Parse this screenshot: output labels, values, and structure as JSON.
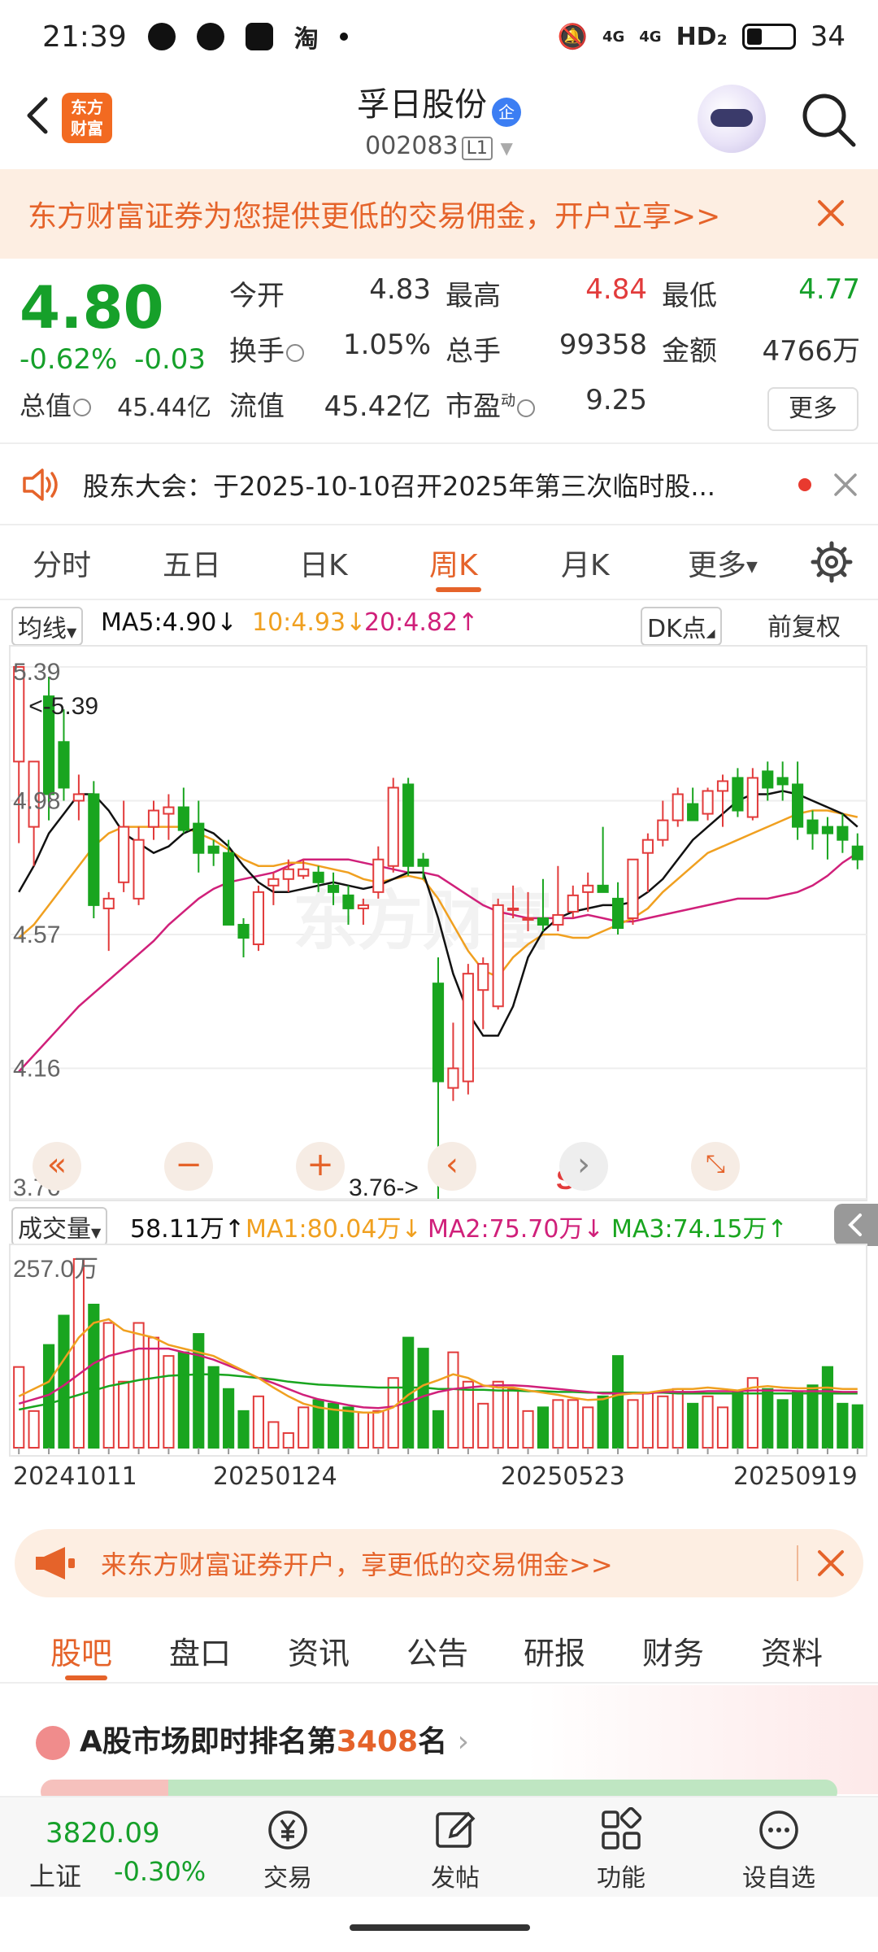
{
  "status": {
    "time": "21:39",
    "taobao": "淘",
    "network": "4G",
    "hd": "HD₂",
    "battery": "34"
  },
  "header": {
    "logo_line1": "东方",
    "logo_line2": "财富",
    "stock_name": "孚日股份",
    "badge": "企",
    "code": "002083",
    "level": "L1"
  },
  "promo_top": {
    "text": "东方财富证券为您提供更低的交易佣金，开户立享>>"
  },
  "quote": {
    "price": "4.80",
    "change_pct": "-0.62%",
    "change": "-0.03",
    "open_label": "今开",
    "open": "4.83",
    "high_label": "最高",
    "high": "4.84",
    "low_label": "最低",
    "low": "4.77",
    "turnover_label": "换手",
    "turnover": "1.05%",
    "volume_label": "总手",
    "volume": "99358",
    "amount_label": "金额",
    "amount": "4766万",
    "mcap_label": "总值",
    "mcap": "45.44亿",
    "float_label": "流值",
    "float": "45.42亿",
    "pe_label": "市盈",
    "pe_sup": "动",
    "pe": "9.25",
    "more": "更多"
  },
  "notice": {
    "text": "股东大会：于2025-10-10召开2025年第三次临时股..."
  },
  "period_tabs": [
    "分时",
    "五日",
    "日K",
    "周K",
    "月K",
    "更多"
  ],
  "ma_bar": {
    "selector": "均线",
    "ma5": "MA5:4.90↓",
    "ma10": "10:4.93↓",
    "ma20": "20:4.82↑",
    "dk": "DK点",
    "adjust": "前复权"
  },
  "vol_bar": {
    "selector": "成交量",
    "vol": "58.11万↑",
    "ma1": "MA1:80.04万↓",
    "ma2": "MA2:75.70万↓",
    "ma3": "MA3:74.15万↑"
  },
  "colors": {
    "up": "#e23b3b",
    "down": "#19a51f",
    "accent": "#e5632a",
    "ma5": "#111111",
    "ma10": "#f0a020",
    "ma20": "#d0207a"
  },
  "chart_data": [
    {
      "type": "candlestick",
      "y_ticks": [
        "5.39",
        "4.98",
        "4.57",
        "4.16",
        "3.76"
      ],
      "ylim": [
        3.76,
        5.39
      ],
      "max_label": "<-5.39",
      "min_label": "3.76->",
      "sell_mark": "S",
      "candles": [
        [
          5.1,
          5.39,
          4.85,
          5.39
        ],
        [
          4.9,
          5.1,
          4.78,
          5.1
        ],
        [
          5.3,
          5.36,
          4.92,
          5.0
        ],
        [
          5.16,
          5.26,
          4.98,
          5.02
        ],
        [
          4.98,
          5.06,
          4.92,
          5.0
        ],
        [
          5.0,
          5.04,
          4.62,
          4.66
        ],
        [
          4.65,
          4.7,
          4.52,
          4.68
        ],
        [
          4.73,
          4.98,
          4.7,
          4.9
        ],
        [
          4.68,
          4.9,
          4.66,
          4.86
        ],
        [
          4.9,
          4.98,
          4.86,
          4.95
        ],
        [
          4.94,
          5.0,
          4.86,
          4.96
        ],
        [
          4.96,
          5.02,
          4.88,
          4.89
        ],
        [
          4.91,
          4.98,
          4.76,
          4.82
        ],
        [
          4.84,
          4.86,
          4.78,
          4.82
        ],
        [
          4.82,
          4.86,
          4.6,
          4.6
        ],
        [
          4.6,
          4.62,
          4.5,
          4.56
        ],
        [
          4.54,
          4.72,
          4.52,
          4.7
        ],
        [
          4.72,
          4.76,
          4.66,
          4.74
        ],
        [
          4.74,
          4.8,
          4.7,
          4.77
        ],
        [
          4.75,
          4.8,
          4.74,
          4.77
        ],
        [
          4.76,
          4.78,
          4.7,
          4.73
        ],
        [
          4.72,
          4.76,
          4.66,
          4.7
        ],
        [
          4.69,
          4.72,
          4.6,
          4.65
        ],
        [
          4.65,
          4.68,
          4.6,
          4.66
        ],
        [
          4.7,
          4.84,
          4.68,
          4.8
        ],
        [
          4.78,
          5.05,
          4.76,
          5.02
        ],
        [
          5.03,
          5.05,
          4.75,
          4.78
        ],
        [
          4.8,
          4.82,
          4.74,
          4.78
        ],
        [
          4.42,
          4.5,
          3.76,
          4.12
        ],
        [
          4.1,
          4.3,
          4.06,
          4.16
        ],
        [
          4.12,
          4.48,
          4.08,
          4.45
        ],
        [
          4.4,
          4.5,
          4.28,
          4.48
        ],
        [
          4.35,
          4.68,
          4.34,
          4.66
        ],
        [
          4.65,
          4.72,
          4.62,
          4.65
        ],
        [
          4.62,
          4.7,
          4.58,
          4.62
        ],
        [
          4.62,
          4.74,
          4.58,
          4.6
        ],
        [
          4.6,
          4.78,
          4.58,
          4.63
        ],
        [
          4.64,
          4.72,
          4.62,
          4.69
        ],
        [
          4.7,
          4.76,
          4.64,
          4.72
        ],
        [
          4.72,
          4.9,
          4.7,
          4.7
        ],
        [
          4.68,
          4.73,
          4.57,
          4.59
        ],
        [
          4.62,
          4.8,
          4.6,
          4.8
        ],
        [
          4.82,
          4.88,
          4.7,
          4.86
        ],
        [
          4.86,
          4.98,
          4.84,
          4.92
        ],
        [
          4.92,
          5.02,
          4.9,
          5.0
        ],
        [
          4.97,
          5.02,
          4.92,
          4.92
        ],
        [
          4.94,
          5.02,
          4.92,
          5.01
        ],
        [
          5.01,
          5.06,
          4.9,
          5.04
        ],
        [
          5.05,
          5.08,
          4.93,
          4.95
        ],
        [
          4.93,
          5.08,
          4.92,
          5.05
        ],
        [
          5.07,
          5.1,
          4.98,
          5.02
        ],
        [
          5.05,
          5.1,
          4.98,
          5.03
        ],
        [
          5.03,
          5.1,
          4.86,
          4.9
        ],
        [
          4.92,
          4.95,
          4.83,
          4.88
        ],
        [
          4.9,
          4.93,
          4.8,
          4.88
        ],
        [
          4.9,
          4.94,
          4.82,
          4.86
        ],
        [
          4.84,
          4.88,
          4.77,
          4.8
        ]
      ],
      "ma5": [
        4.7,
        4.78,
        4.88,
        4.94,
        5.0,
        5.0,
        4.95,
        4.88,
        4.85,
        4.82,
        4.84,
        4.88,
        4.9,
        4.88,
        4.84,
        4.78,
        4.73,
        4.7,
        4.7,
        4.71,
        4.72,
        4.73,
        4.72,
        4.71,
        4.72,
        4.74,
        4.76,
        4.76,
        4.62,
        4.45,
        4.33,
        4.26,
        4.26,
        4.35,
        4.5,
        4.58,
        4.62,
        4.64,
        4.65,
        4.66,
        4.66,
        4.67,
        4.7,
        4.74,
        4.8,
        4.86,
        4.9,
        4.94,
        4.98,
        5.0,
        5.0,
        5.01,
        5.0,
        4.98,
        4.96,
        4.94,
        4.9
      ],
      "ma10": [
        4.56,
        4.6,
        4.66,
        4.72,
        4.78,
        4.84,
        4.88,
        4.9,
        4.9,
        4.9,
        4.9,
        4.9,
        4.88,
        4.86,
        4.83,
        4.8,
        4.78,
        4.78,
        4.79,
        4.79,
        4.78,
        4.77,
        4.76,
        4.74,
        4.73,
        4.74,
        4.75,
        4.74,
        4.68,
        4.6,
        4.52,
        4.46,
        4.44,
        4.5,
        4.54,
        4.57,
        4.57,
        4.56,
        4.56,
        4.58,
        4.6,
        4.62,
        4.65,
        4.7,
        4.74,
        4.78,
        4.82,
        4.84,
        4.86,
        4.88,
        4.9,
        4.92,
        4.94,
        4.95,
        4.95,
        4.94,
        4.93
      ],
      "ma20": [
        4.15,
        4.2,
        4.25,
        4.3,
        4.35,
        4.39,
        4.43,
        4.47,
        4.51,
        4.55,
        4.6,
        4.64,
        4.68,
        4.71,
        4.73,
        4.74,
        4.75,
        4.76,
        4.78,
        4.8,
        4.8,
        4.8,
        4.8,
        4.79,
        4.78,
        4.77,
        4.76,
        4.76,
        4.75,
        4.72,
        4.69,
        4.66,
        4.64,
        4.63,
        4.62,
        4.62,
        4.62,
        4.62,
        4.63,
        4.62,
        4.61,
        4.61,
        4.62,
        4.63,
        4.64,
        4.65,
        4.66,
        4.67,
        4.68,
        4.68,
        4.68,
        4.69,
        4.7,
        4.72,
        4.75,
        4.79,
        4.82
      ]
    },
    {
      "type": "bar",
      "y_ticks": [
        "257.0万"
      ],
      "ylim": [
        0,
        257
      ],
      "volumes": [
        110,
        50,
        140,
        180,
        257,
        195,
        170,
        90,
        170,
        150,
        125,
        130,
        155,
        110,
        80,
        50,
        70,
        35,
        20,
        55,
        65,
        60,
        55,
        48,
        50,
        95,
        150,
        135,
        50,
        130,
        90,
        60,
        90,
        80,
        50,
        55,
        65,
        65,
        55,
        70,
        125,
        65,
        75,
        70,
        80,
        60,
        70,
        55,
        75,
        95,
        80,
        65,
        75,
        85,
        110,
        60,
        58
      ],
      "ma1": [
        70,
        80,
        90,
        120,
        150,
        170,
        175,
        160,
        155,
        150,
        140,
        135,
        130,
        125,
        115,
        105,
        95,
        82,
        70,
        60,
        55,
        52,
        50,
        48,
        48,
        55,
        72,
        85,
        92,
        100,
        95,
        85,
        82,
        82,
        78,
        75,
        72,
        68,
        65,
        66,
        72,
        74,
        75,
        78,
        80,
        80,
        82,
        80,
        78,
        82,
        84,
        82,
        81,
        81,
        82,
        80,
        80
      ],
      "ma2": [
        60,
        66,
        72,
        85,
        100,
        115,
        125,
        130,
        135,
        135,
        135,
        130,
        126,
        120,
        112,
        104,
        95,
        88,
        80,
        72,
        66,
        62,
        58,
        55,
        54,
        56,
        62,
        70,
        76,
        80,
        82,
        84,
        85,
        85,
        84,
        82,
        80,
        78,
        76,
        74,
        74,
        74,
        74,
        76,
        76,
        76,
        77,
        77,
        77,
        78,
        78,
        78,
        77,
        77,
        77,
        76,
        76
      ],
      "ma3": [
        52,
        56,
        60,
        66,
        72,
        78,
        84,
        88,
        92,
        95,
        98,
        99,
        100,
        100,
        99,
        97,
        95,
        93,
        90,
        88,
        86,
        85,
        84,
        83,
        82,
        82,
        82,
        82,
        80,
        80,
        79,
        79,
        78,
        78,
        77,
        77,
        76,
        76,
        75,
        75,
        75,
        75,
        75,
        75,
        74,
        74,
        74,
        74,
        74,
        74,
        74,
        74,
        74,
        74,
        74,
        74,
        74
      ]
    }
  ],
  "x_labels": [
    "20241011",
    "20250124",
    "20250523",
    "20250919"
  ],
  "promo_bottom": {
    "text": "来东方财富证券开户，享更低的交易佣金>>"
  },
  "bottom_tabs": [
    "股吧",
    "盘口",
    "资讯",
    "公告",
    "研报",
    "财务",
    "资料"
  ],
  "ranking": {
    "prefix": "A股市场即时排名第",
    "rank": "3408",
    "suffix": "名"
  },
  "bottom_nav": {
    "index_value": "3820.09",
    "index_name": "上证",
    "index_change": "-0.30%",
    "trade": "交易",
    "post": "发帖",
    "features": "功能",
    "watch": "设自选"
  }
}
